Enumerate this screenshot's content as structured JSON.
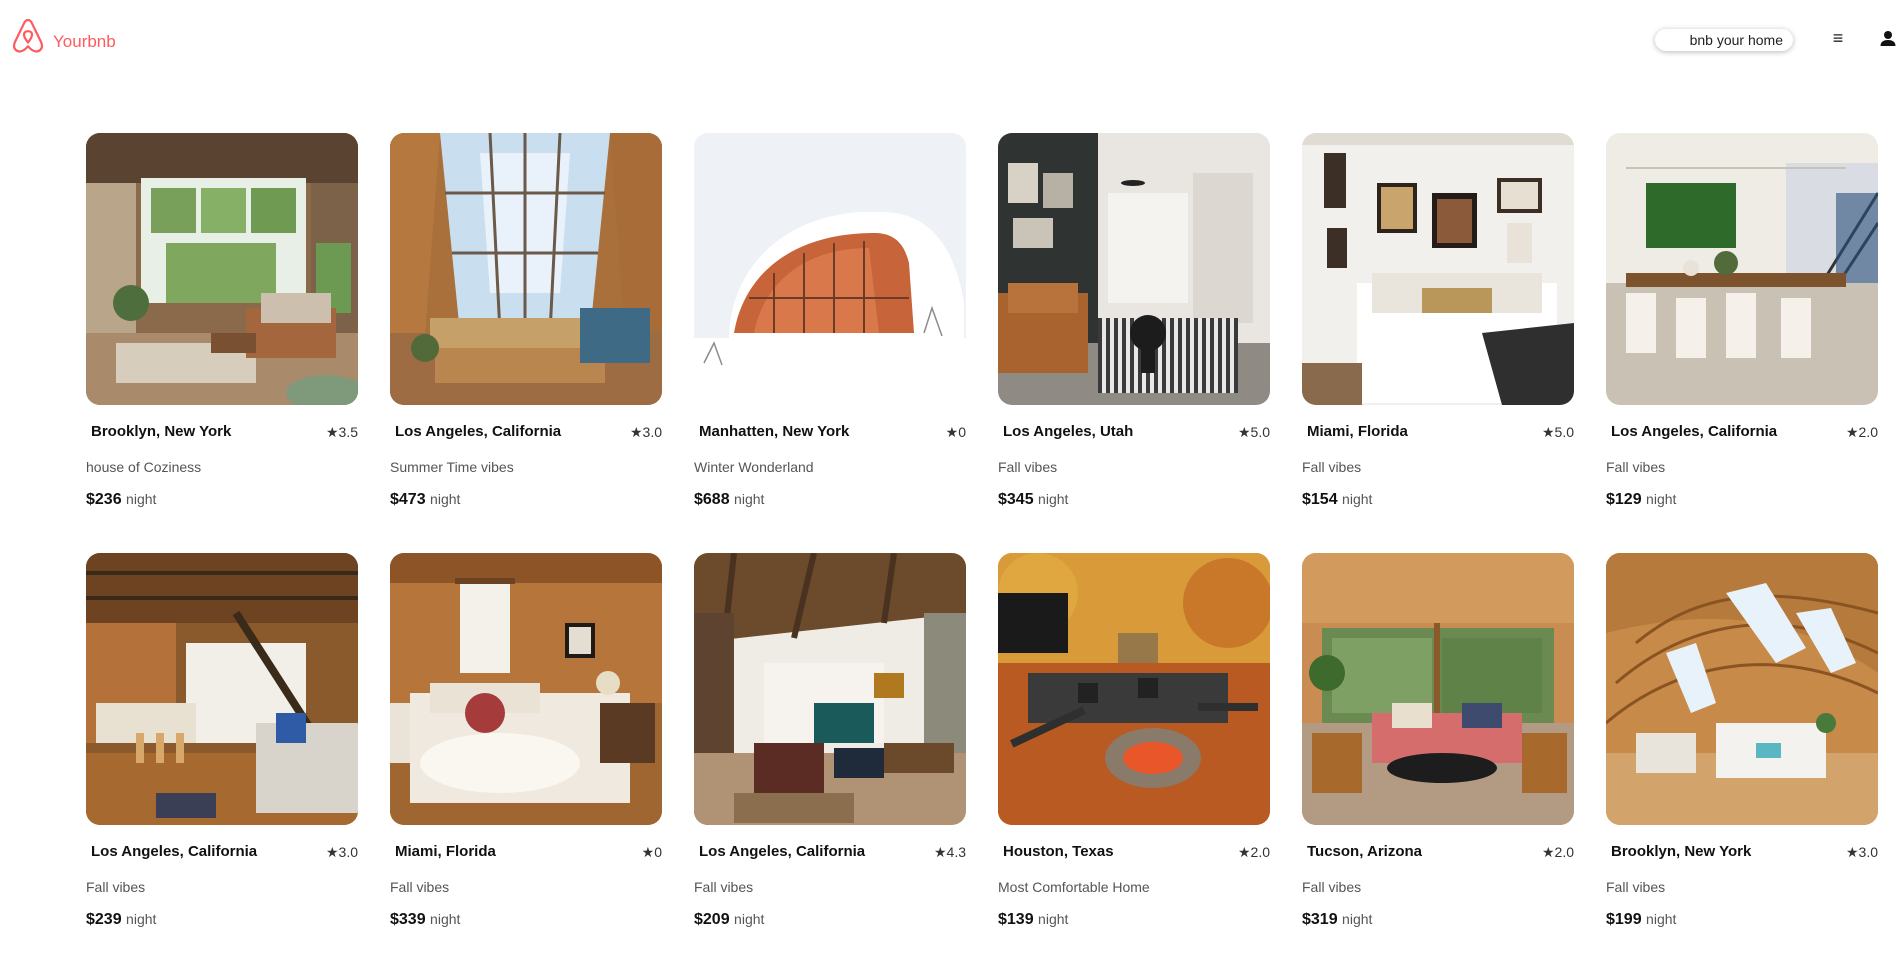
{
  "brand": {
    "name": "Yourbnb",
    "color": "#ff5a5f",
    "logo_icon": "airbnb-belo-icon"
  },
  "header": {
    "host_label": "bnb your home",
    "menu_glyph": "≡",
    "menu_icon": "hamburger-menu-icon",
    "user_icon": "user-account-icon"
  },
  "listings": [
    {
      "location": "Brooklyn, New York",
      "rating": "★3.5",
      "description": "house of Coziness",
      "price": "$236",
      "unit": "night",
      "scene": "cabin-livingroom"
    },
    {
      "location": "Los Angeles, California",
      "rating": "★3.0",
      "description": "Summer Time vibes",
      "price": "$473",
      "unit": "night",
      "scene": "glass-aframe"
    },
    {
      "location": "Manhatten, New York",
      "rating": "★0",
      "description": "Winter Wonderland",
      "price": "$688",
      "unit": "night",
      "scene": "snow-dome"
    },
    {
      "location": "Los Angeles, Utah",
      "rating": "★5.0",
      "description": "Fall vibes",
      "price": "$345",
      "unit": "night",
      "scene": "modern-livingroom"
    },
    {
      "location": "Miami, Florida",
      "rating": "★5.0",
      "description": "Fall vibes",
      "price": "$154",
      "unit": "night",
      "scene": "gallery-bedroom"
    },
    {
      "location": "Los Angeles, California",
      "rating": "★2.0",
      "description": "Fall vibes",
      "price": "$129",
      "unit": "night",
      "scene": "dining-room"
    },
    {
      "location": "Los Angeles, California",
      "rating": "★3.0",
      "description": "Fall vibes",
      "price": "$239",
      "unit": "night",
      "scene": "loft-kitchen"
    },
    {
      "location": "Miami, Florida",
      "rating": "★0",
      "description": "Fall vibes",
      "price": "$339",
      "unit": "night",
      "scene": "wood-bedroom"
    },
    {
      "location": "Los Angeles, California",
      "rating": "★4.3",
      "description": "Fall vibes",
      "price": "$209",
      "unit": "night",
      "scene": "rustic-livingroom"
    },
    {
      "location": "Houston, Texas",
      "rating": "★2.0",
      "description": "Most Comfortable Home",
      "price": "$139",
      "unit": "night",
      "scene": "firepit-patio"
    },
    {
      "location": "Tucson, Arizona",
      "rating": "★2.0",
      "description": "Fall vibes",
      "price": "$319",
      "unit": "night",
      "scene": "forest-lounge"
    },
    {
      "location": "Brooklyn, New York",
      "rating": "★3.0",
      "description": "Fall vibes",
      "price": "$199",
      "unit": "night",
      "scene": "wooden-dome"
    }
  ]
}
